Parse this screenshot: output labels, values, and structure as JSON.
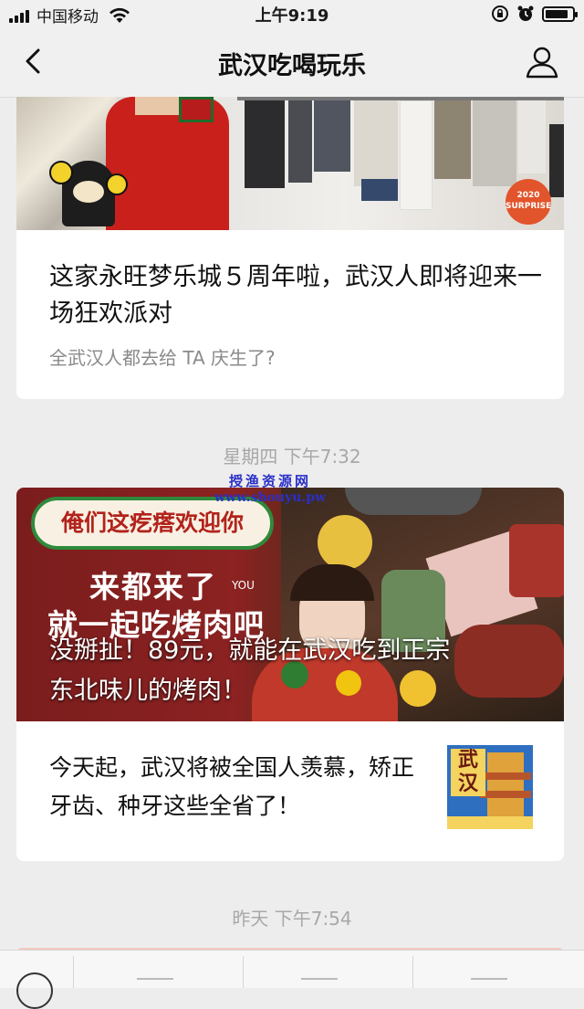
{
  "status_bar": {
    "carrier": "中国移动",
    "time": "上午9:19",
    "battery_level": 0.85
  },
  "nav": {
    "title": "武汉吃喝玩乐",
    "back_icon": "chevron-left-icon",
    "profile_icon": "person-icon"
  },
  "messages": [
    {
      "image_badge": "2020 SURPRISE",
      "title": "这家永旺梦乐城５周年啦，武汉人即将迎来一场狂欢派对",
      "subtitle": "全武汉人都去给 TA 庆生了?"
    },
    {
      "timestamp": "星期四 下午7:32",
      "banner": {
        "pill": "俺们这疙瘩欢迎你",
        "line1": "来都来了",
        "you": "YOU",
        "line2": "就一起吃烤肉吧",
        "overlay1": "没掰扯！89元，就能在武汉吃到正宗",
        "overlay2": "东北味儿的烤肉！"
      },
      "title": "今天起，武汉将被全国人羡慕，矫正牙齿、种牙这些全省了！",
      "thumb_text": "武汉"
    },
    {
      "timestamp": "昨天 下午7:54"
    }
  ],
  "watermark": {
    "line1": "授渔资源网",
    "line2": "www.shouyu.pw"
  },
  "colors": {
    "background": "#ededed",
    "card": "#ffffff",
    "timestamp": "#a8a8a8",
    "banner_red": "#8c2222",
    "pill_green": "#2f8a3c"
  }
}
